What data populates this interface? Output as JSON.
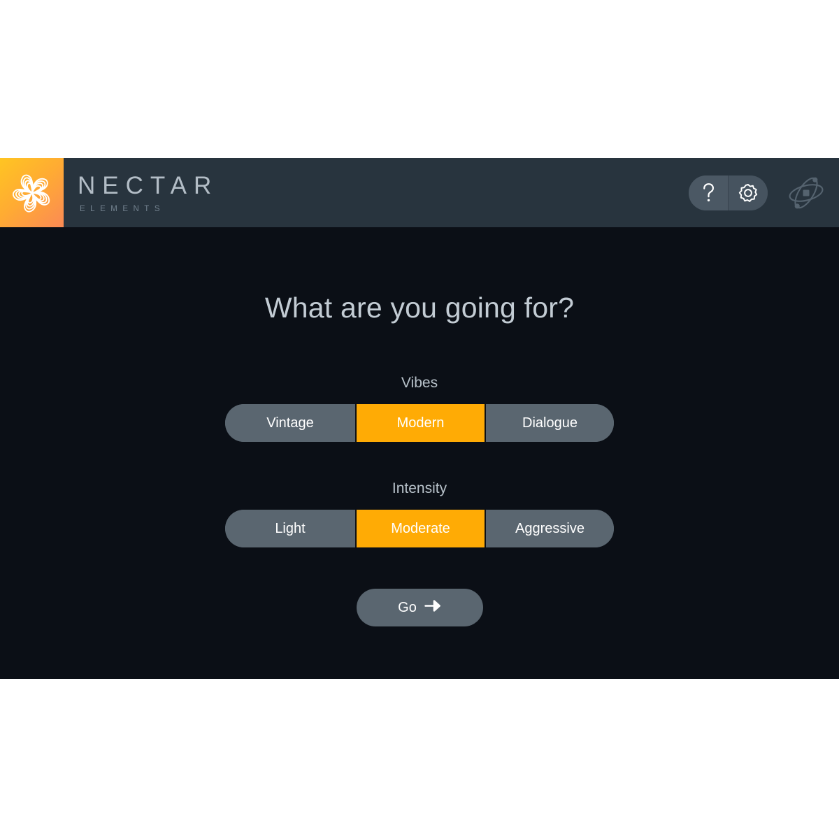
{
  "header": {
    "brand_name": "NECTAR",
    "brand_subtitle": "ELEMENTS",
    "logo_icon": "nectar-pinwheel-logo",
    "help_icon": "question-mark-icon",
    "settings_icon": "gear-icon",
    "vendor_icon": "izotope-orbit-logo",
    "colors": {
      "header_bg": "#28343e",
      "logo_gradient_start": "#ffc522",
      "logo_gradient_end": "#fb8a55",
      "brand_text": "#b3bdc6",
      "brand_sub_text": "#73828f"
    }
  },
  "main": {
    "title": "What are you going for?",
    "groups": [
      {
        "label": "Vibes",
        "options": [
          {
            "label": "Vintage",
            "selected": false
          },
          {
            "label": "Modern",
            "selected": true
          },
          {
            "label": "Dialogue",
            "selected": false
          }
        ]
      },
      {
        "label": "Intensity",
        "options": [
          {
            "label": "Light",
            "selected": false
          },
          {
            "label": "Moderate",
            "selected": true
          },
          {
            "label": "Aggressive",
            "selected": false
          }
        ]
      }
    ],
    "go_button": {
      "label": "Go",
      "icon": "arrow-right-icon"
    },
    "colors": {
      "background": "#0b0f16",
      "title_text": "#c3ccd4",
      "segment_bg": "#5a6670",
      "segment_selected_bg": "#ffab05",
      "segment_text": "#ffffff"
    }
  }
}
